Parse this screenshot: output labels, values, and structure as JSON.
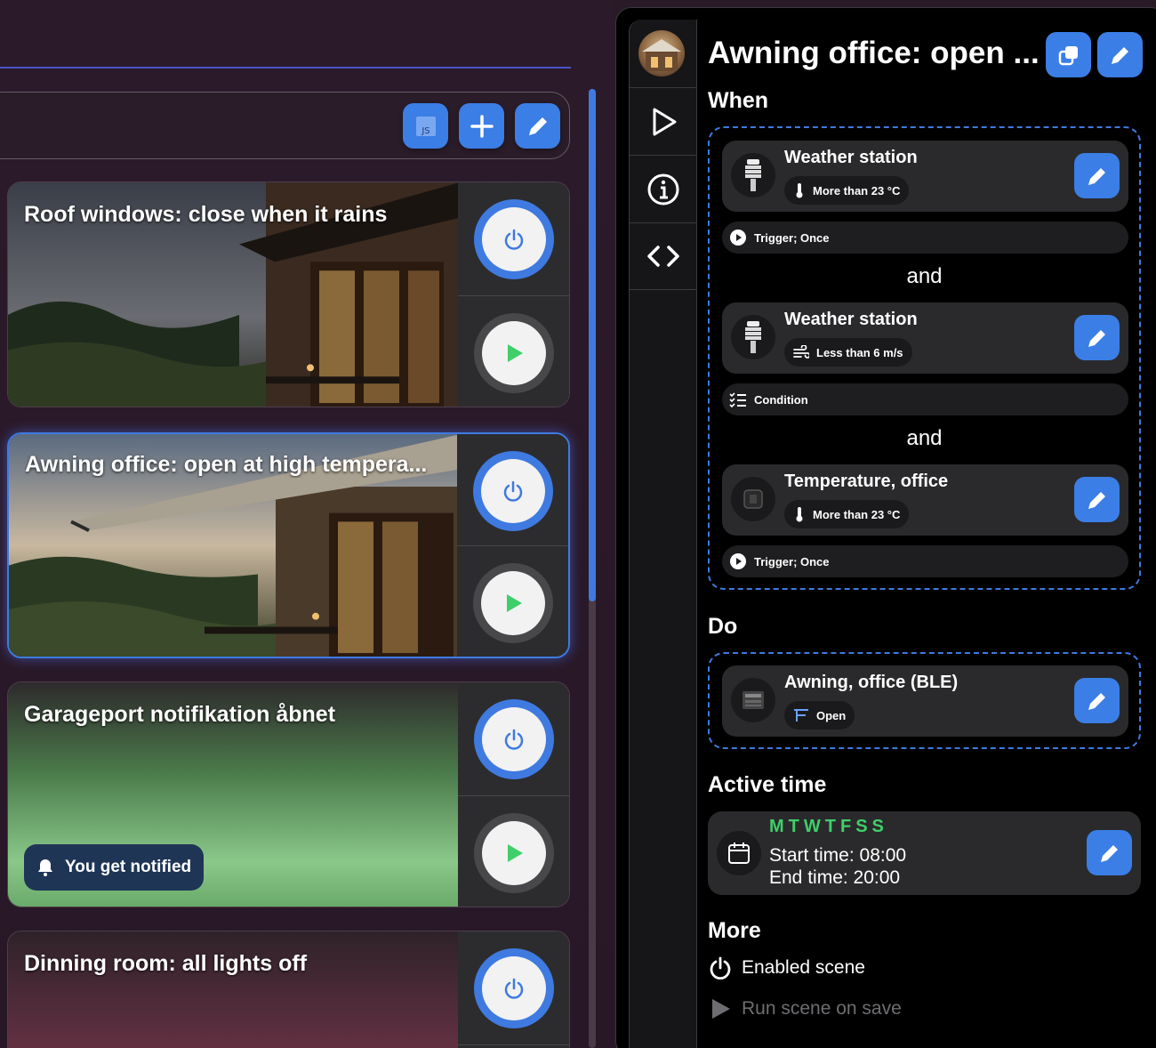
{
  "left": {
    "toolbar": {
      "js_icon": "js-icon",
      "add_icon": "plus-icon",
      "edit_icon": "pencil-icon"
    },
    "cards": [
      {
        "title": "Roof windows: close when it rains"
      },
      {
        "title": "Awning office: open at high tempera..."
      },
      {
        "title": "Garageport notifikation åbnet",
        "chip": "You get notified"
      },
      {
        "title": "Dinning room: all lights off"
      }
    ]
  },
  "panel": {
    "title": "Awning office: open ...",
    "when_heading": "When",
    "conditions": [
      {
        "device": "Weather station",
        "chip": "More than 23 °C",
        "chip_icon": "thermometer-icon",
        "sub": "Trigger; Once",
        "sub_icon": "play-circle-icon"
      },
      {
        "device": "Weather station",
        "chip": "Less than 6 m/s",
        "chip_icon": "wind-icon",
        "sub": "Condition",
        "sub_icon": "list-icon"
      },
      {
        "device": "Temperature, office",
        "chip": "More than 23 °C",
        "chip_icon": "thermometer-icon",
        "sub": "Trigger; Once",
        "sub_icon": "play-circle-icon"
      }
    ],
    "and_label": "and",
    "do_heading": "Do",
    "action": {
      "device": "Awning, office (BLE)",
      "chip": "Open"
    },
    "active_heading": "Active time",
    "days": "MTWTFSS",
    "start_time": "Start time: 08:00",
    "end_time": "End time: 20:00",
    "more_heading": "More",
    "enabled_scene": "Enabled scene",
    "run_on_save": "Run scene on save"
  }
}
